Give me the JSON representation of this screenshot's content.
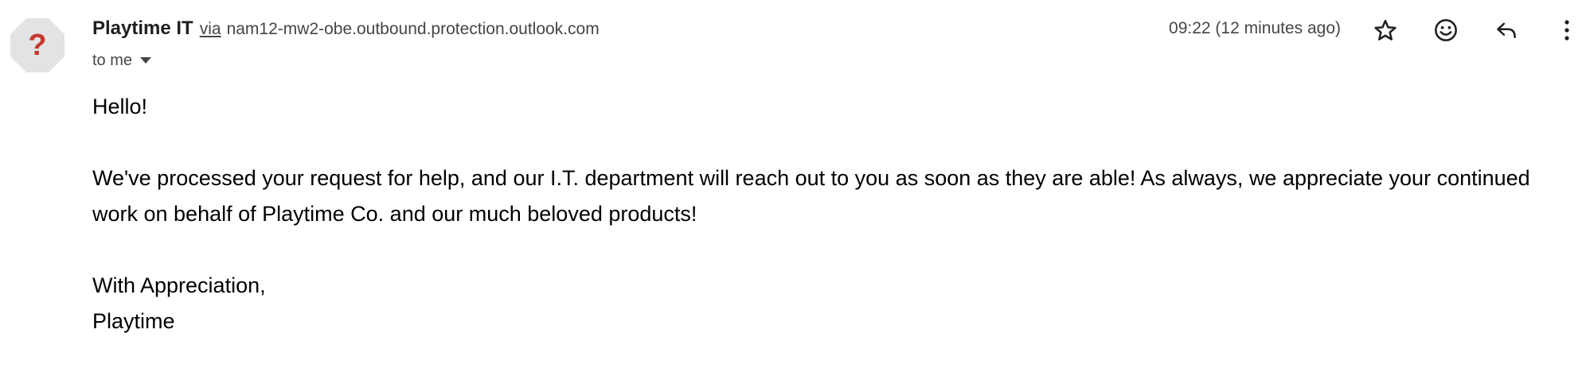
{
  "sender": {
    "avatar_glyph": "?",
    "name": "Playtime IT",
    "via_label": "via",
    "via_domain": "nam12-mw2-obe.outbound.protection.outlook.com",
    "recipient_label": "to me"
  },
  "meta": {
    "time": "09:22 (12 minutes ago)"
  },
  "actions": {
    "icons": [
      "star-icon",
      "emoji-icon",
      "reply-icon",
      "more-vert-icon"
    ]
  },
  "body": {
    "greeting": "Hello!",
    "message": "We've processed your request for help, and our I.T. department will reach out to you as soon as they are able! As always, we appreciate your continued work on behalf of Playtime Co. and our much beloved products!",
    "closing": "With Appreciation,",
    "signature": "Playtime"
  },
  "colors": {
    "avatar_bg": "#e3e3e3",
    "avatar_glyph": "#c5392f",
    "secondary_text": "#444746",
    "body_text": "#000000"
  }
}
